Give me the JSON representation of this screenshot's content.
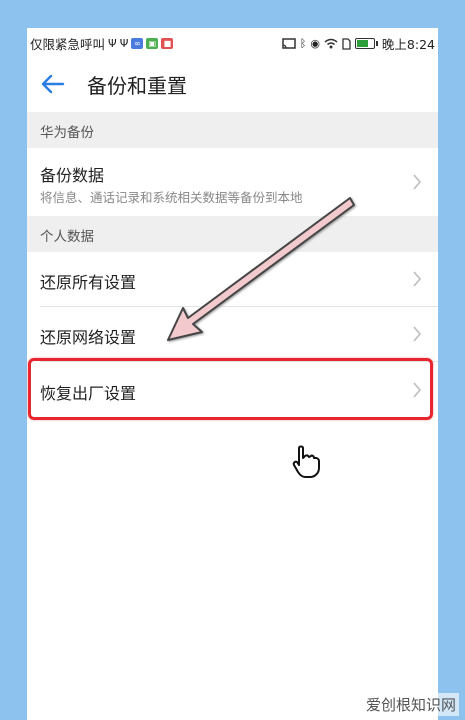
{
  "status_bar": {
    "left_text": "仅限紧急呼叫",
    "time": "晚上8:24",
    "icons": [
      "usb-icon",
      "usb-icon",
      "app-notification-icon",
      "app-notification-icon",
      "app-notification-icon",
      "cast-icon",
      "bluetooth-icon",
      "eye-icon",
      "wifi-icon",
      "sim-icon",
      "battery-icon"
    ]
  },
  "app_bar": {
    "title": "备份和重置"
  },
  "sections": [
    {
      "header": "华为备份",
      "items": [
        {
          "label": "备份数据",
          "subtitle": "将信息、通话记录和系统相关数据等备份到本地"
        }
      ]
    },
    {
      "header": "个人数据",
      "items": [
        {
          "label": "还原所有设置"
        },
        {
          "label": "还原网络设置"
        },
        {
          "label": "恢复出厂设置"
        }
      ]
    }
  ],
  "colors": {
    "highlight": "#e8262f",
    "back_arrow": "#2a7de1",
    "background": "#8ec2ee"
  },
  "watermark": "爱创根知识网"
}
